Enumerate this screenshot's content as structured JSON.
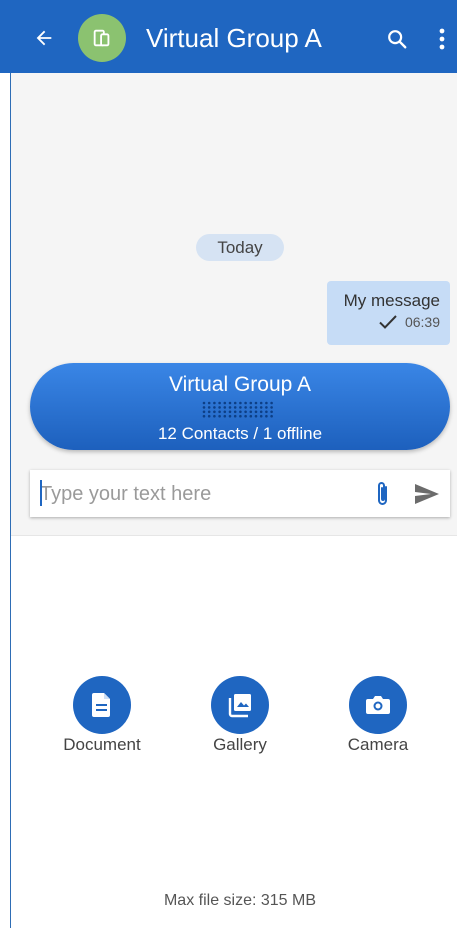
{
  "header": {
    "title": "Virtual Group A",
    "back_icon": "arrow-back-icon",
    "avatar_icon": "devices-icon",
    "search_icon": "search-icon",
    "more_icon": "more-vert-icon",
    "color": "#1f66c1",
    "avatar_color": "#8bc270"
  },
  "chat": {
    "date_label": "Today",
    "messages": [
      {
        "direction": "outgoing",
        "text": "My message",
        "time": "06:39",
        "status_icon": "check-icon"
      }
    ],
    "group_card": {
      "name": "Virtual Group A",
      "status": "12 Contacts / 1 offline",
      "indicator_icon": "dot-grid-icon"
    }
  },
  "composer": {
    "placeholder": "Type your text here",
    "value": "",
    "attach_icon": "paperclip-icon",
    "send_icon": "send-icon"
  },
  "attachments": {
    "options": [
      {
        "label": "Document",
        "icon": "document-icon"
      },
      {
        "label": "Gallery",
        "icon": "gallery-icon"
      },
      {
        "label": "Camera",
        "icon": "camera-icon"
      }
    ],
    "max_file_size": "Max file size: 315 MB"
  }
}
